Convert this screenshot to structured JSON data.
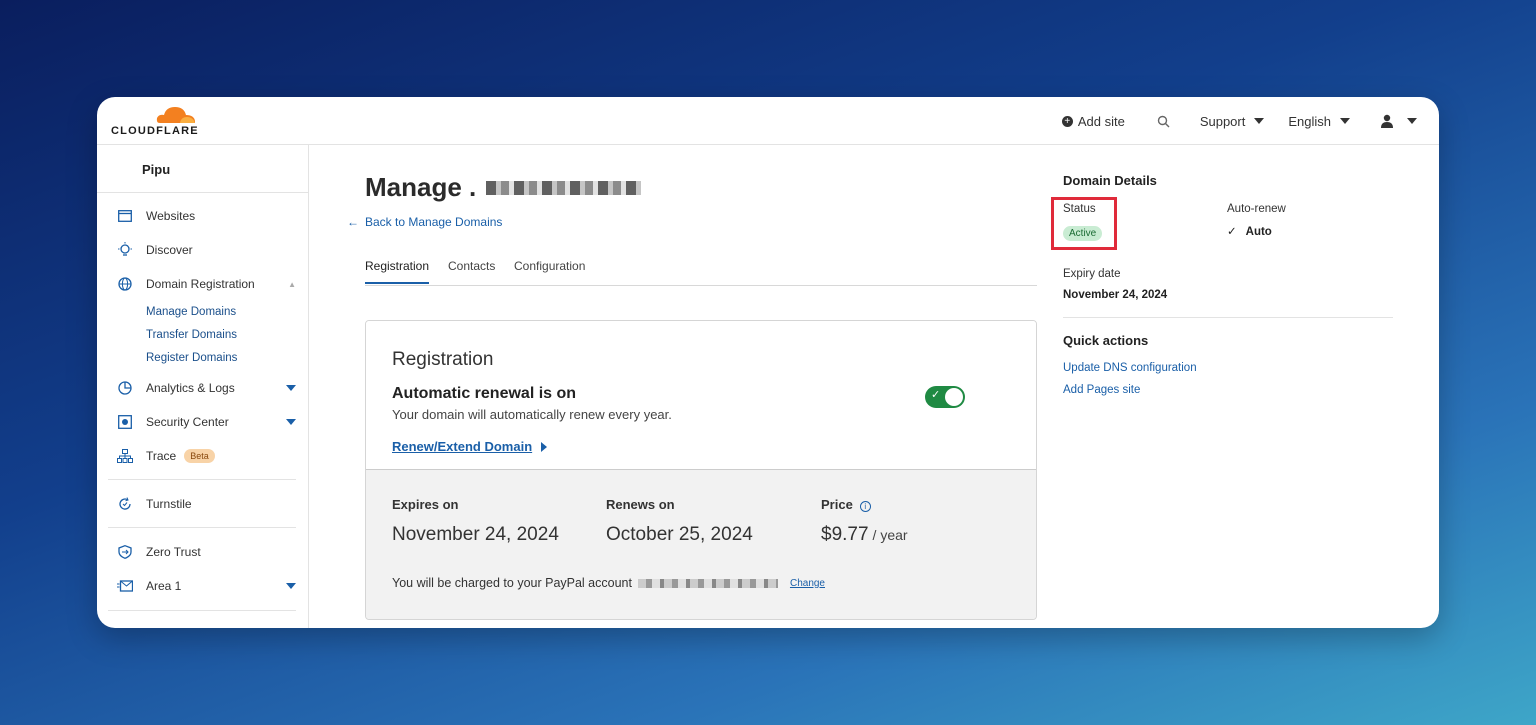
{
  "header": {
    "logo_text": "CLOUDFLARE",
    "add_site": "Add site",
    "support": "Support",
    "language": "English",
    "brand_color": "#f38020"
  },
  "sidebar": {
    "account": "Pipu",
    "items": [
      {
        "label": "Websites",
        "icon": "browser-window-icon"
      },
      {
        "label": "Discover",
        "icon": "lightbulb-icon"
      },
      {
        "label": "Domain Registration",
        "icon": "globe-icon"
      },
      {
        "label": "Analytics & Logs",
        "icon": "pie-chart-icon"
      },
      {
        "label": "Security Center",
        "icon": "shield-icon"
      },
      {
        "label": "Trace",
        "icon": "network-icon",
        "badge": "Beta"
      },
      {
        "label": "Turnstile",
        "icon": "refresh-icon"
      },
      {
        "label": "Zero Trust",
        "icon": "zero-trust-icon"
      },
      {
        "label": "Area 1",
        "icon": "mail-icon"
      }
    ],
    "sub_items": [
      "Manage Domains",
      "Transfer Domains",
      "Register Domains"
    ]
  },
  "main": {
    "title": "Manage .",
    "back_link": "Back to Manage Domains",
    "tabs": [
      "Registration",
      "Contacts",
      "Configuration"
    ],
    "card": {
      "title": "Registration",
      "renew_title": "Automatic renewal is on",
      "renew_desc": "Your domain will automatically renew every year.",
      "renew_link": "Renew/Extend Domain",
      "toggle_on": true,
      "expires_label": "Expires on",
      "expires_value": "November 24, 2024",
      "renews_label": "Renews on",
      "renews_value": "October 25, 2024",
      "price_label": "Price",
      "price_value": "$9.77",
      "price_unit": "/ year",
      "charge_text": "You will be charged to your PayPal account",
      "change": "Change"
    }
  },
  "details": {
    "heading": "Domain Details",
    "status_label": "Status",
    "status_value": "Active",
    "autorenew_label": "Auto-renew",
    "autorenew_value": "Auto",
    "expiry_label": "Expiry date",
    "expiry_value": "November 24, 2024",
    "quick_heading": "Quick actions",
    "quick_links": [
      "Update DNS configuration",
      "Add Pages site"
    ]
  }
}
